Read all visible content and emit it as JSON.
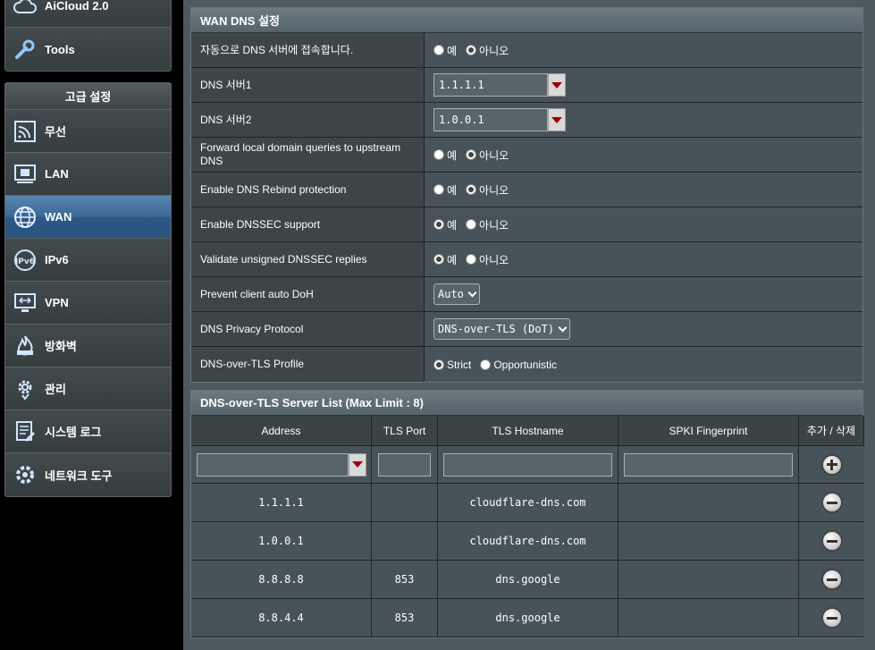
{
  "sidebar": {
    "top_items": [
      {
        "label": "AiCloud 2.0",
        "icon": "cloud-icon"
      },
      {
        "label": "Tools",
        "icon": "wrench-icon"
      }
    ],
    "section_title": "고급 설정",
    "items": [
      {
        "label": "무선",
        "icon": "wireless-icon"
      },
      {
        "label": "LAN",
        "icon": "lan-icon"
      },
      {
        "label": "WAN",
        "icon": "globe-icon",
        "active": true
      },
      {
        "label": "IPv6",
        "icon": "ipv6-icon"
      },
      {
        "label": "VPN",
        "icon": "vpn-icon"
      },
      {
        "label": "방화벽",
        "icon": "firewall-icon"
      },
      {
        "label": "관리",
        "icon": "gear-icon"
      },
      {
        "label": "시스템 로그",
        "icon": "log-icon"
      },
      {
        "label": "네트워크 도구",
        "icon": "network-tools-icon"
      }
    ]
  },
  "wan_dns": {
    "title": "WAN DNS 설정",
    "rows": {
      "auto_dns": {
        "label": "자동으로 DNS 서버에 접속합니다.",
        "yes": "예",
        "no": "아니오",
        "selected": "no"
      },
      "dns1": {
        "label": "DNS 서버1",
        "value": "1.1.1.1"
      },
      "dns2": {
        "label": "DNS 서버2",
        "value": "1.0.0.1"
      },
      "forward_local": {
        "label": "Forward local domain queries to upstream DNS",
        "yes": "예",
        "no": "아니오",
        "selected": "no"
      },
      "rebind": {
        "label": "Enable DNS Rebind protection",
        "yes": "예",
        "no": "아니오",
        "selected": "no"
      },
      "dnssec": {
        "label": "Enable DNSSEC support",
        "yes": "예",
        "no": "아니오",
        "selected": "yes"
      },
      "validate_unsigned": {
        "label": "Validate unsigned DNSSEC replies",
        "yes": "예",
        "no": "아니오",
        "selected": "yes"
      },
      "client_doh": {
        "label": "Prevent client auto DoH",
        "value": "Auto"
      },
      "privacy_protocol": {
        "label": "DNS Privacy Protocol",
        "value": "DNS-over-TLS (DoT)"
      },
      "dot_profile": {
        "label": "DNS-over-TLS Profile",
        "strict": "Strict",
        "opportunistic": "Opportunistic",
        "selected": "strict"
      }
    }
  },
  "server_list": {
    "title": "DNS-over-TLS Server List (Max Limit : 8)",
    "headers": [
      "Address",
      "TLS Port",
      "TLS Hostname",
      "SPKI Fingerprint",
      "추가 / 삭제"
    ],
    "rows": [
      {
        "address": "1.1.1.1",
        "port": "",
        "hostname": "cloudflare-dns.com",
        "spki": ""
      },
      {
        "address": "1.0.0.1",
        "port": "",
        "hostname": "cloudflare-dns.com",
        "spki": ""
      },
      {
        "address": "8.8.8.8",
        "port": "853",
        "hostname": "dns.google",
        "spki": ""
      },
      {
        "address": "8.8.4.4",
        "port": "853",
        "hostname": "dns.google",
        "spki": ""
      }
    ]
  }
}
